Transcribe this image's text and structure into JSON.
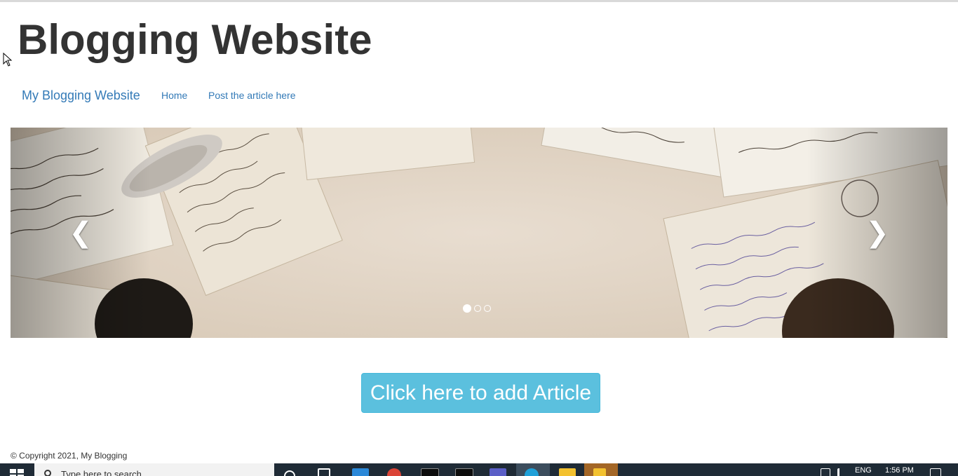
{
  "header": {
    "title": "Blogging Website"
  },
  "navbar": {
    "brand": "My Blogging Website",
    "links": [
      "Home",
      "Post the article here"
    ]
  },
  "carousel": {
    "prev_icon": "chevron-left-icon",
    "next_icon": "chevron-right-icon",
    "slide_count": 3,
    "active_index": 0
  },
  "main": {
    "add_article_label": "Click here to add Article",
    "button_color": "#5bc0de"
  },
  "footer": {
    "copyright": "© Copyright 2021, My Blogging"
  },
  "taskbar": {
    "search_placeholder": "Type here to search",
    "language": "ENG",
    "time": "1:56 PM"
  },
  "colors": {
    "link": "#337ab7",
    "title": "#333333",
    "taskbar": "#1f2b36"
  }
}
